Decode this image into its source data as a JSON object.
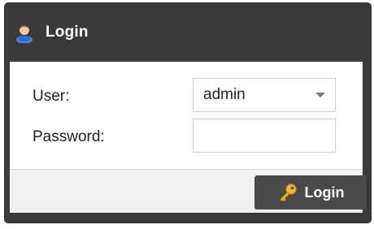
{
  "dialog": {
    "title": "Login",
    "title_icon": "user-icon"
  },
  "form": {
    "user_label": "User:",
    "user_value": "admin",
    "password_label": "Password:",
    "password_value": ""
  },
  "footer": {
    "login_label": "Login",
    "login_icon": "key-icon"
  },
  "colors": {
    "title_bar": "#3a3a3a",
    "button": "#4a4a4a",
    "footer": "#f0f0f0"
  }
}
